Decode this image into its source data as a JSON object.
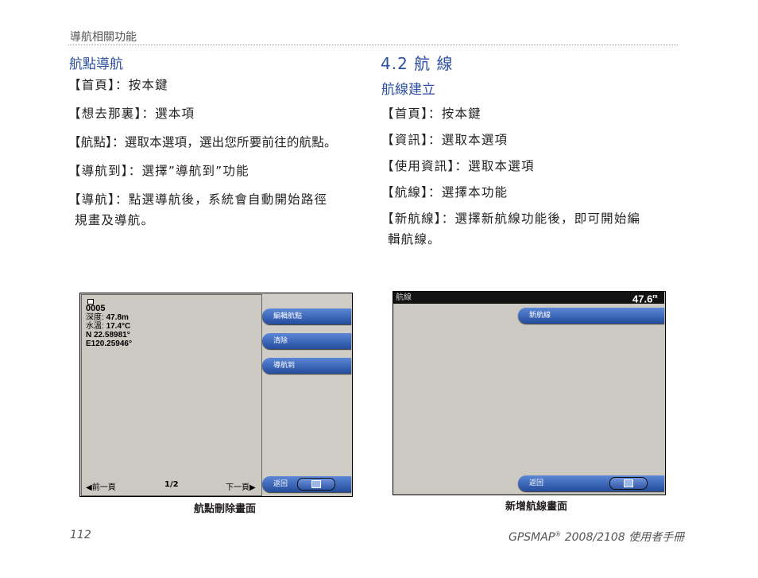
{
  "header": {
    "chapter": "導航相關功能"
  },
  "left_section": {
    "title": "航點導航",
    "items": [
      {
        "text": "【首頁】：按本鍵"
      },
      {
        "text": "【想去那裏】：選本項"
      },
      {
        "text": "【航點】：選取本選項，選出您所要前往的航點。"
      },
      {
        "text": "【導航到】：選擇”導航到”功能"
      },
      {
        "text": "【導航】：點選導航後，系統會自動開始路徑",
        "cont": "規畫及導航。"
      }
    ]
  },
  "right_section": {
    "title": "4.2 航 線",
    "subtitle": "航線建立",
    "items": [
      {
        "text": "【首頁】：按本鍵"
      },
      {
        "text": "【資訊】：選取本選項"
      },
      {
        "text": "【使用資訊】：選取本選項"
      },
      {
        "text": "【航線】：選擇本功能"
      },
      {
        "text": "【新航線】：選擇新航線功能後，即可開始編",
        "cont": "輯航線。"
      }
    ]
  },
  "screenshot_left": {
    "waypoint_name": "0005",
    "depth_label": "深度:",
    "depth_value": "47.8m",
    "temp_label": "水溫:",
    "temp_value": "17.4°C",
    "lat": "N  22.58981°",
    "lon": "E120.25946°",
    "buttons": [
      "編輯航點",
      "清除",
      "導航到"
    ],
    "back_button": "返回",
    "prev_page": "前一頁",
    "page_indicator": "1/2",
    "next_page": "下一頁",
    "caption": "航點刪除畫面"
  },
  "screenshot_right": {
    "title": "航線",
    "depth_reading": "47.6",
    "depth_unit": "m",
    "buttons": [
      "新航線"
    ],
    "back_button": "返回",
    "caption": "新增航線畫面"
  },
  "footer": {
    "page_number": "112",
    "manual_title": "GPSMAP",
    "registered": "®",
    "manual_subtitle": " 2008/2108 使用者手冊"
  }
}
